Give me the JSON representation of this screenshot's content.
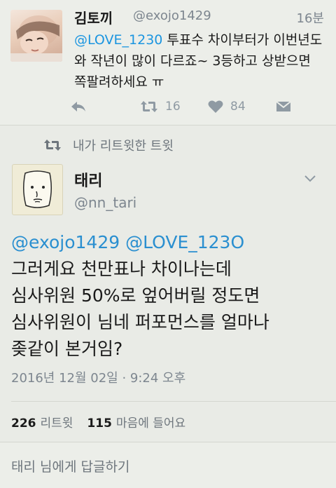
{
  "reply_tweet": {
    "name": "김토끼",
    "handle": "@exojo1429",
    "time": "16분",
    "mention": "@LOVE_1230",
    "text_after_mention": " 투표수 차이부터가 이번년도와 작년이 많이 다르죠~ 3등하고 상받으면 쪽팔려하세요 ㅠ",
    "retweet_count": "16",
    "like_count": "84",
    "icons": [
      "reply-icon",
      "retweet-icon",
      "heart-icon",
      "dm-icon"
    ]
  },
  "retweet_label": "내가 리트윗한 트윗",
  "main_tweet": {
    "name": "태리",
    "handle": "@nn_tari",
    "mentions": "@exojo1429 @LOVE_123O",
    "lines": [
      "그러게요 천만표나 차이나는데",
      "심사위원 50%로 엎어버릴 정도면",
      "심사위원이 님네 퍼포먼스를 얼마나",
      "좆같이 본거임?"
    ],
    "date": "2016년 12월 02일 · 9:24 오후",
    "retweets_num": "226",
    "retweets_label": "리트윗",
    "likes_num": "115",
    "likes_label": "마음에 들어요"
  },
  "reply_placeholder": "태리 님에게 답글하기",
  "colors": {
    "mention": "#1b95e0",
    "secondary_text": "#7d868f",
    "background": "#e9ebe6"
  }
}
